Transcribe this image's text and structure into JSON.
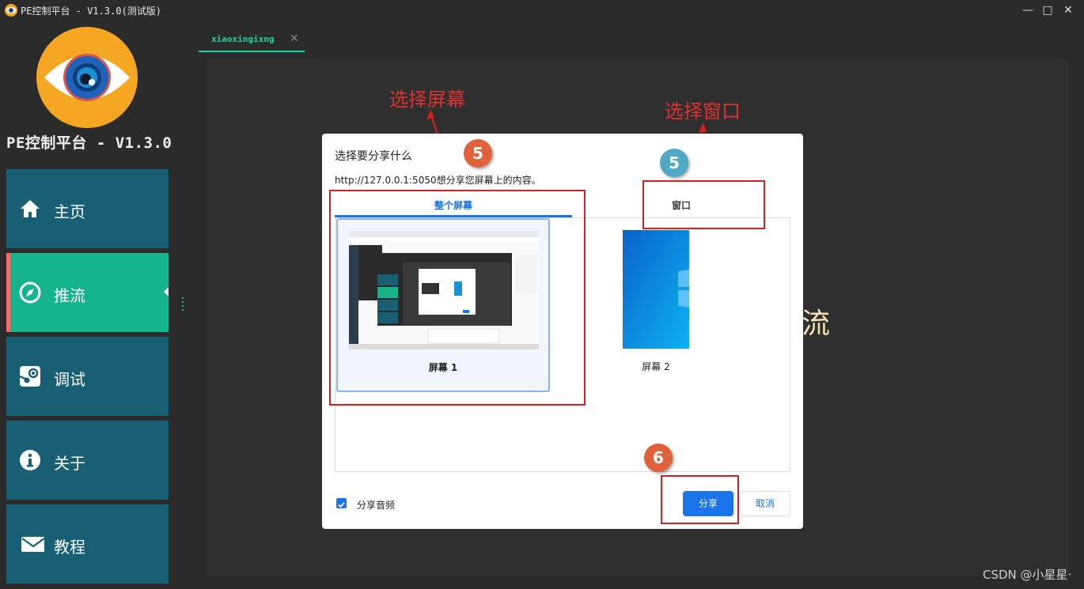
{
  "window": {
    "title": "PE控制平台 - V1.3.0(测试版)",
    "controls": [
      "—",
      "□",
      "✕"
    ]
  },
  "sidebar": {
    "app_name": "PE控制平台 - V1.3.0",
    "items": [
      {
        "label": "主页",
        "icon": "home-icon",
        "active": false
      },
      {
        "label": "推流",
        "icon": "compass-icon",
        "active": true
      },
      {
        "label": "调试",
        "icon": "steam-icon",
        "active": false
      },
      {
        "label": "关于",
        "icon": "info-icon",
        "active": false
      },
      {
        "label": "教程",
        "icon": "envelope-icon",
        "active": false
      }
    ]
  },
  "tabs": [
    {
      "label": "xiaoxingixng",
      "close": "✕"
    }
  ],
  "content": {
    "background_text": "流"
  },
  "annotations": {
    "select_screen": "选择屏幕",
    "select_window": "选择窗口",
    "badge_screen": "5",
    "badge_window": "5",
    "badge_share": "6"
  },
  "dialog": {
    "title": "选择要分享什么",
    "description": "http://127.0.0.1:5050想分享您屏幕上的内容。",
    "tabs": [
      "整个屏幕",
      "窗口"
    ],
    "active_tab": "整个屏幕",
    "sources": [
      {
        "label": "屏幕 1",
        "selected": true
      },
      {
        "label": "屏幕 2",
        "selected": false
      }
    ],
    "share_audio_label": "分享音频",
    "share_audio_checked": true,
    "share_button": "分享",
    "cancel_button": "取消"
  },
  "watermark": "CSDN @小星星·",
  "colors": {
    "sidebar_item": "#185f73",
    "sidebar_active": "#15b48a",
    "active_marker": "#f46a6a",
    "accent_blue": "#1a73e8",
    "annotation_red": "#d42020",
    "badge_orange": "#e0623c",
    "badge_teal": "#4fa8c4"
  }
}
